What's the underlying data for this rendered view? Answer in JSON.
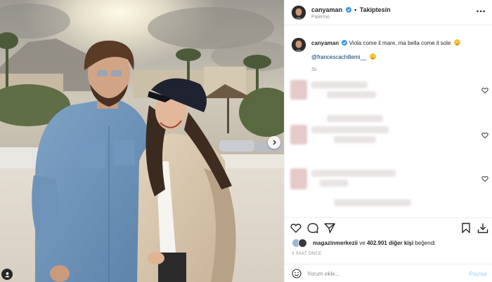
{
  "post": {
    "username": "canyaman",
    "follow_label": "Takiptesin",
    "location": "Palermo"
  },
  "caption": {
    "username": "canyaman",
    "text": "Viola come il mare, ma bella come il sole",
    "mention": "@francescachillemi__",
    "time": "3s"
  },
  "likes": {
    "first_user": "magazinmerkezii",
    "connector": "ve",
    "rest": "402.901 diğer kişi",
    "suffix": "beğendi"
  },
  "time_ago": "3 SAAT ÖNCE",
  "comment_input": {
    "placeholder": "Yorum ekle...",
    "submit_label": "Paylaş"
  },
  "colors": {
    "verified": "#3897f0",
    "link": "#00376b",
    "muted": "#8e8e8e",
    "post_button": "#b2dffc"
  },
  "icons": {
    "header": [
      "verified-icon",
      "more-icon"
    ],
    "photo": [
      "carousel-next-icon",
      "user-tag-icon"
    ],
    "actions": [
      "heart-icon",
      "comment-icon",
      "share-icon",
      "bookmark-icon",
      "download-icon"
    ],
    "comment_box": [
      "smile-icon"
    ]
  }
}
